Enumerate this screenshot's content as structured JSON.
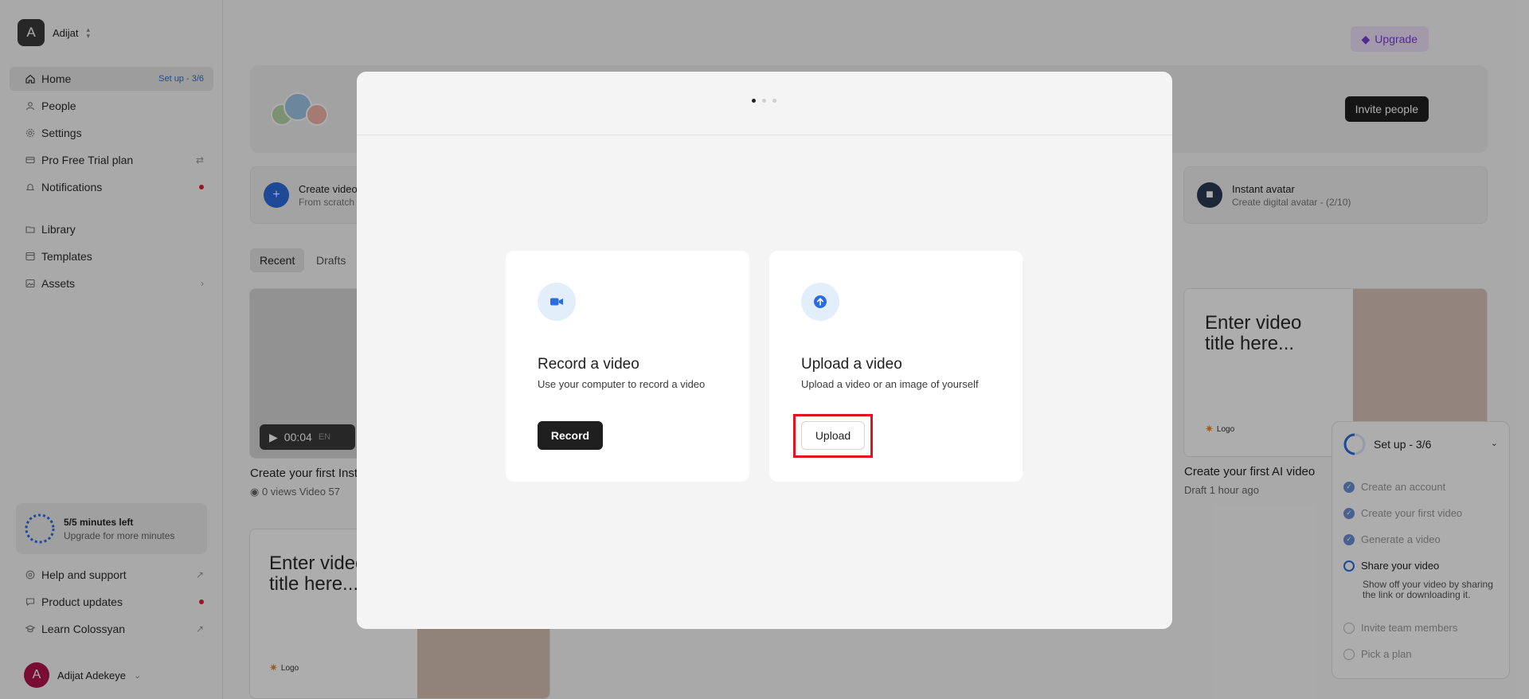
{
  "workspace": {
    "initial": "A",
    "name": "Adijat"
  },
  "sidebar": {
    "home": {
      "label": "Home",
      "setup": "Set up - 3/6"
    },
    "items": [
      {
        "label": "People"
      },
      {
        "label": "Settings"
      },
      {
        "label": "Pro Free Trial plan"
      },
      {
        "label": "Notifications"
      },
      {
        "label": "Library"
      },
      {
        "label": "Templates"
      },
      {
        "label": "Assets"
      }
    ],
    "minutes": {
      "title": "5/5 minutes left",
      "subtitle": "Upgrade for more minutes"
    },
    "bottom": [
      {
        "label": "Help and support"
      },
      {
        "label": "Product updates"
      },
      {
        "label": "Learn Colossyan"
      }
    ],
    "user": {
      "initial": "A",
      "name": "Adijat Adekeye"
    }
  },
  "header": {
    "upgrade": "Upgrade",
    "invite": "Invite people"
  },
  "quick": {
    "create": {
      "title": "Create video",
      "subtitle": "From scratch"
    },
    "avatar": {
      "title": "Instant avatar",
      "subtitle": "Create digital avatar - (2/10)"
    }
  },
  "tabs": [
    "Recent",
    "Drafts"
  ],
  "cards": {
    "first": {
      "duration": "00:04",
      "lang": "EN",
      "caption": "Create your first Inst",
      "meta": "0 views   Video   57"
    },
    "ai": {
      "title_line1": "Enter video",
      "title_line2": "title here...",
      "logo": "Logo",
      "caption": "Create your first AI video",
      "meta": "Draft    1 hour ago"
    },
    "draft2": {
      "title_line1": "Enter video",
      "title_line2": "title here...",
      "logo": "Logo"
    }
  },
  "setup_panel": {
    "title": "Set up - 3/6",
    "items": [
      {
        "label": "Create an account",
        "state": "done"
      },
      {
        "label": "Create your first video",
        "state": "done"
      },
      {
        "label": "Generate a video",
        "state": "done"
      },
      {
        "label": "Share your video",
        "state": "current"
      },
      {
        "label": "Invite team members",
        "state": "todo"
      },
      {
        "label": "Pick a plan",
        "state": "todo"
      }
    ],
    "current_desc": "Show off your video by sharing the link or downloading it."
  },
  "modal": {
    "step_total": 3,
    "step_current": 1,
    "record": {
      "title": "Record a video",
      "desc": "Use your computer to record a video",
      "button": "Record"
    },
    "upload": {
      "title": "Upload a video",
      "desc": "Upload a video or an image of yourself",
      "button": "Upload"
    }
  },
  "colors": {
    "accent": "#2d6cdf",
    "highlight": "#e0141e",
    "upgrade": "#7b3fd0"
  }
}
